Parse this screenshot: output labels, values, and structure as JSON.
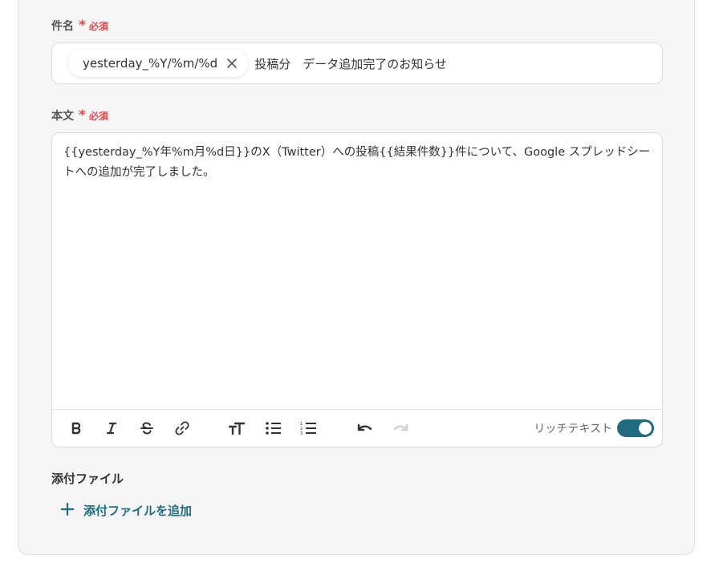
{
  "subject": {
    "label": "件名",
    "required_star": "*",
    "required_text": "必須",
    "chip_text": "yesterday_%Y/%m/%d",
    "text_after_chip": "投稿分　データ追加完了のお知らせ"
  },
  "body": {
    "label": "本文",
    "required_star": "*",
    "required_text": "必須",
    "content": "{{yesterday_%Y年%m月%d日}}のX（Twitter）への投稿{{結果件数}}件について、Google スプレッドシートへの追加が完了しました。"
  },
  "toolbar": {
    "icons": [
      "bold-icon",
      "italic-icon",
      "strikethrough-icon",
      "link-icon",
      "text-size-icon",
      "bullet-list-icon",
      "numbered-list-icon",
      "undo-icon",
      "redo-icon"
    ],
    "rich_text_label": "リッチテキスト",
    "rich_text_enabled": true
  },
  "attachment": {
    "label": "添付ファイル",
    "add_label": "添付ファイルを追加"
  },
  "colors": {
    "accent": "#1f6b80",
    "required": "#e5484d"
  }
}
